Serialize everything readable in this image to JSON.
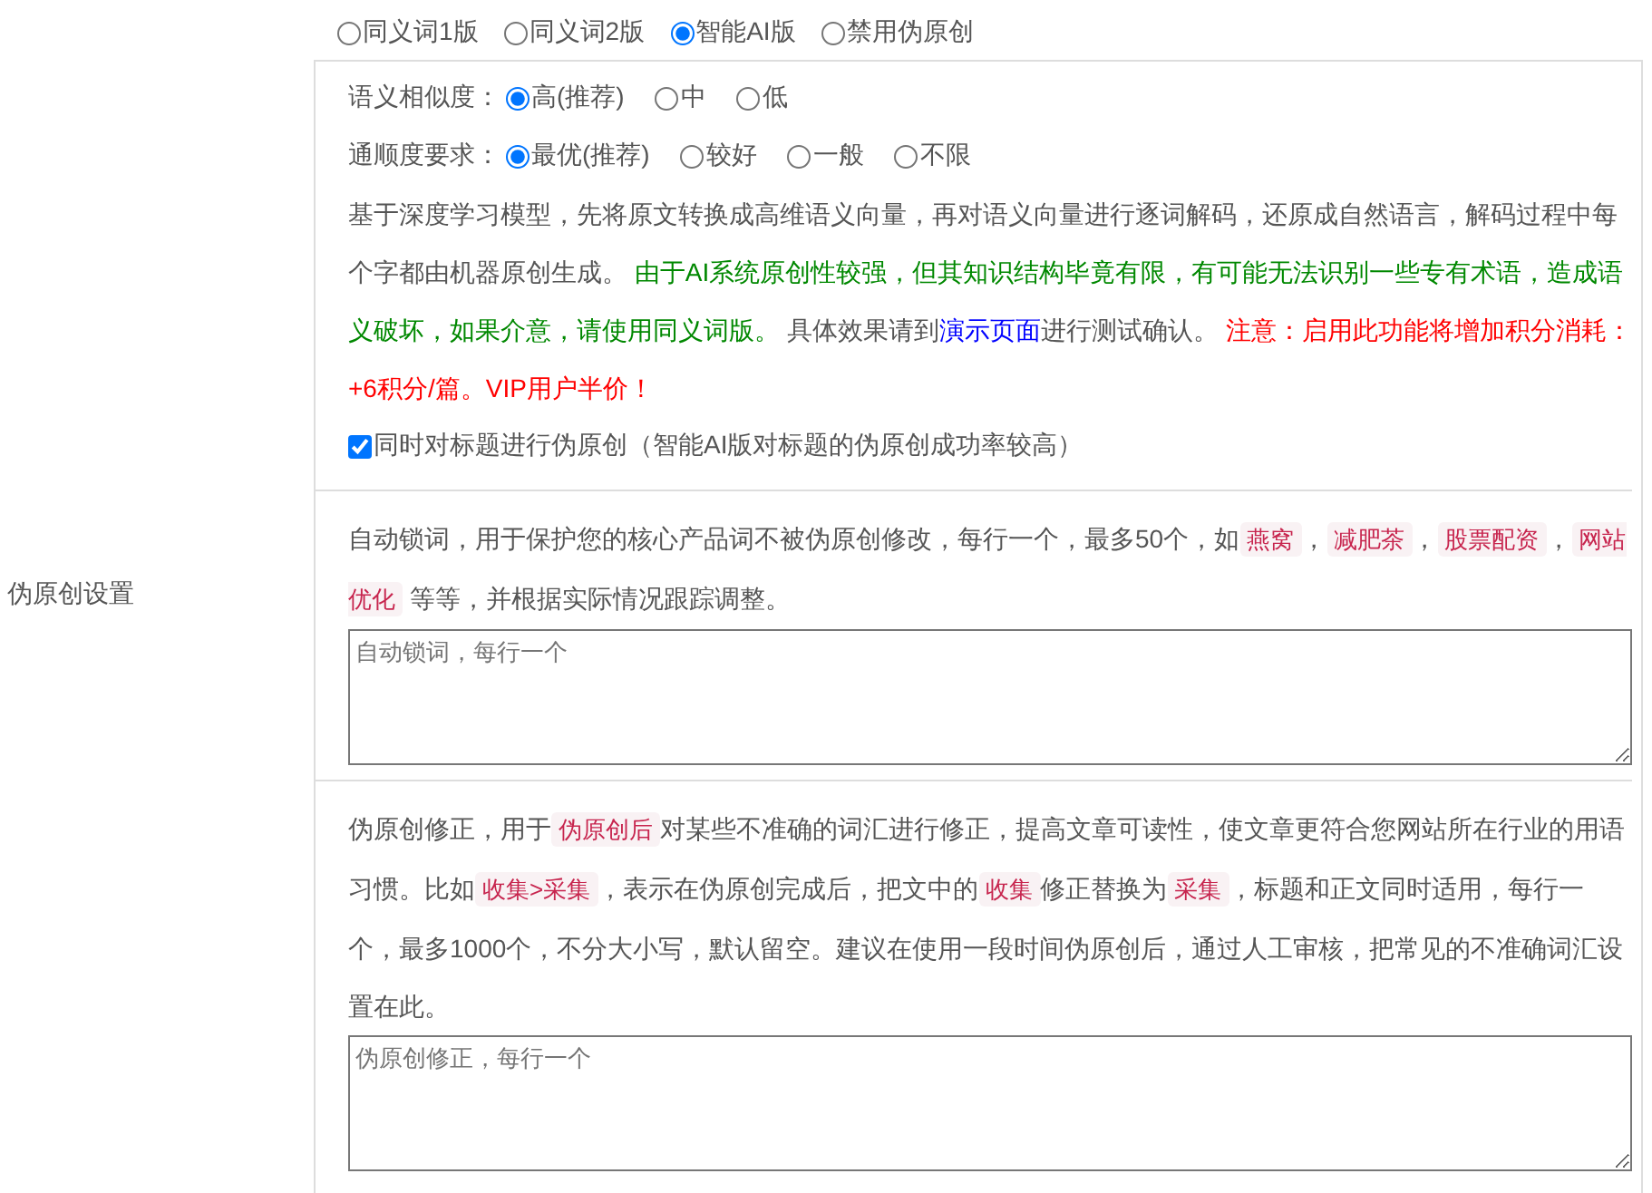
{
  "sidebar_label": "伪原创设置",
  "versions": [
    {
      "label": "同义词1版",
      "selected": false
    },
    {
      "label": "同义词2版",
      "selected": false
    },
    {
      "label": "智能AI版",
      "selected": true
    },
    {
      "label": "禁用伪原创",
      "selected": false
    }
  ],
  "similarity": {
    "label": "语义相似度：",
    "options": [
      {
        "label": "高(推荐)",
        "selected": true
      },
      {
        "label": "中",
        "selected": false
      },
      {
        "label": "低",
        "selected": false
      }
    ]
  },
  "fluency": {
    "label": "通顺度要求：",
    "options": [
      {
        "label": "最优(推荐)",
        "selected": true
      },
      {
        "label": "较好",
        "selected": false
      },
      {
        "label": "一般",
        "selected": false
      },
      {
        "label": "不限",
        "selected": false
      }
    ]
  },
  "description": [
    {
      "kind": "plain",
      "text": "基于深度学习模型，先将原文转换成高维语义向量，再对语义向量进行逐词解码，还原成自然语言，解码过程中每个字都由机器原创生成。 "
    },
    {
      "kind": "green",
      "text": "由于AI系统原创性较强，但其知识结构毕竟有限，有可能无法识别一些专有术语，造成语义破坏，如果介意，请使用同义词版。"
    },
    {
      "kind": "plain",
      "text": " 具体效果请到"
    },
    {
      "kind": "link",
      "text": "演示页面"
    },
    {
      "kind": "plain",
      "text": "进行测试确认。 "
    },
    {
      "kind": "red",
      "text": "注意：启用此功能将增加积分消耗：+6积分/篇。VIP用户半价！"
    }
  ],
  "title_option": {
    "label": "同时对标题进行伪原创（智能AI版对标题的伪原创成功率较高）",
    "checked": true
  },
  "lock_words": {
    "description": [
      {
        "kind": "plain",
        "text": "自动锁词，用于保护您的核心产品词不被伪原创修改，每行一个，最多50个，如"
      },
      {
        "kind": "code",
        "text": "燕窝"
      },
      {
        "kind": "plain",
        "text": "，"
      },
      {
        "kind": "code",
        "text": "减肥茶"
      },
      {
        "kind": "plain",
        "text": "，"
      },
      {
        "kind": "code",
        "text": "股票配资"
      },
      {
        "kind": "plain",
        "text": "，"
      },
      {
        "kind": "code",
        "text": "网站优化"
      },
      {
        "kind": "plain",
        "text": " 等等，并根据实际情况跟踪调整。"
      }
    ],
    "placeholder": "自动锁词，每行一个"
  },
  "correction": {
    "description": [
      {
        "kind": "plain",
        "text": "伪原创修正，用于"
      },
      {
        "kind": "code",
        "text": "伪原创后"
      },
      {
        "kind": "plain",
        "text": "对某些不准确的词汇进行修正，提高文章可读性，使文章更符合您网站所在行业的用语习惯。比如"
      },
      {
        "kind": "code",
        "text": "收集>采集"
      },
      {
        "kind": "plain",
        "text": "，表示在伪原创完成后，把文中的"
      },
      {
        "kind": "code",
        "text": "收集"
      },
      {
        "kind": "plain",
        "text": "修正替换为"
      },
      {
        "kind": "code",
        "text": "采集"
      },
      {
        "kind": "plain",
        "text": "，标题和正文同时适用，每行一个，最多1000个，不分大小写，默认留空。建议在使用一段时间伪原创后，通过人工审核，把常见的不准确词汇设置在此。"
      }
    ],
    "placeholder": "伪原创修正，每行一个"
  }
}
